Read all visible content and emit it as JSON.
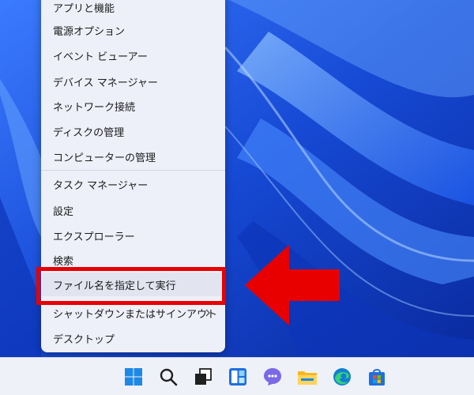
{
  "menu": {
    "items": [
      {
        "label": "アプリと機能"
      },
      {
        "label": "電源オプション"
      },
      {
        "label": "イベント ビューアー"
      },
      {
        "label": "デバイス マネージャー"
      },
      {
        "label": "ネットワーク接続"
      },
      {
        "label": "ディスクの管理"
      },
      {
        "label": "コンピューターの管理"
      },
      {
        "label": "タスク マネージャー"
      },
      {
        "label": "設定"
      },
      {
        "label": "エクスプローラー"
      },
      {
        "label": "検索"
      },
      {
        "label": "ファイル名を指定して実行"
      },
      {
        "label": "シャットダウンまたはサインアウト"
      },
      {
        "label": "デスクトップ"
      }
    ]
  },
  "colors": {
    "callout": "#e80000",
    "menu_background": "#eef0f9",
    "wallpaper": "#1a4fd6"
  },
  "taskbar": {
    "icons": [
      "windows-start-icon",
      "search-icon",
      "task-view-icon",
      "widgets-icon",
      "teams-chat-icon",
      "file-explorer-icon",
      "edge-browser-icon",
      "microsoft-store-icon"
    ]
  }
}
